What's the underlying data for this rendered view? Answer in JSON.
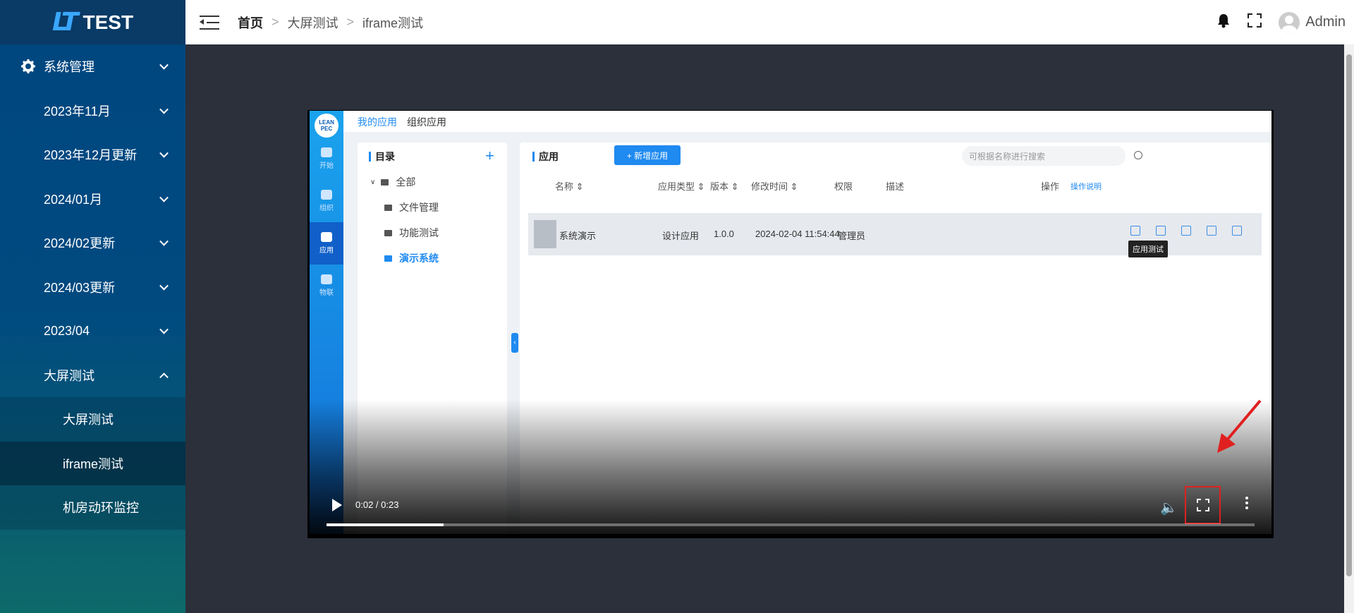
{
  "app": {
    "logo_mark": "LT",
    "logo_text": "TEST"
  },
  "sidebar": {
    "items": [
      {
        "label": "系统管理",
        "icon": "gear-icon"
      },
      {
        "label": "2023年11月",
        "icon": "grid-icon"
      },
      {
        "label": "2023年12月更新",
        "icon": "grid-icon"
      },
      {
        "label": "2024/01月",
        "icon": "grid-icon"
      },
      {
        "label": "2024/02更新",
        "icon": "grid-icon"
      },
      {
        "label": "2024/03更新",
        "icon": "grid-icon"
      },
      {
        "label": "2023/04",
        "icon": "grid-icon"
      },
      {
        "label": "大屏测试",
        "icon": "grid-icon",
        "expanded": true
      }
    ],
    "subitems": [
      {
        "label": "大屏测试"
      },
      {
        "label": "iframe测试",
        "active": true
      },
      {
        "label": "机房动环监控"
      }
    ]
  },
  "header": {
    "breadcrumb": [
      "首页",
      "大屏测试",
      "iframe测试"
    ],
    "user": "Admin"
  },
  "video": {
    "time": "0:02 / 0:23",
    "progress": 0.126,
    "app": {
      "rail_logo": "LEAN PEC",
      "rail": [
        "开始",
        "组织",
        "应用",
        "物联"
      ],
      "rail_active": 2,
      "tabs": [
        "我的应用",
        "组织应用"
      ],
      "dir_title": "目录",
      "tree": [
        "全部",
        "文件管理",
        "功能测试",
        "演示系统"
      ],
      "app_title": "应用",
      "new_button": "+ 新增应用",
      "search_placeholder": "可根据名称进行搜索",
      "headers": [
        "名称 ⇕",
        "应用类型 ⇕",
        "版本 ⇕",
        "修改时间 ⇕",
        "权限",
        "描述",
        "操作",
        "操作说明"
      ],
      "row": [
        "系统演示",
        "设计应用",
        "1.0.0",
        "2024-02-04 11:54:44",
        "管理员"
      ],
      "tooltip": "应用测试"
    }
  },
  "colors": {
    "accent": "#1f8af0",
    "highlight": "#e02020"
  }
}
